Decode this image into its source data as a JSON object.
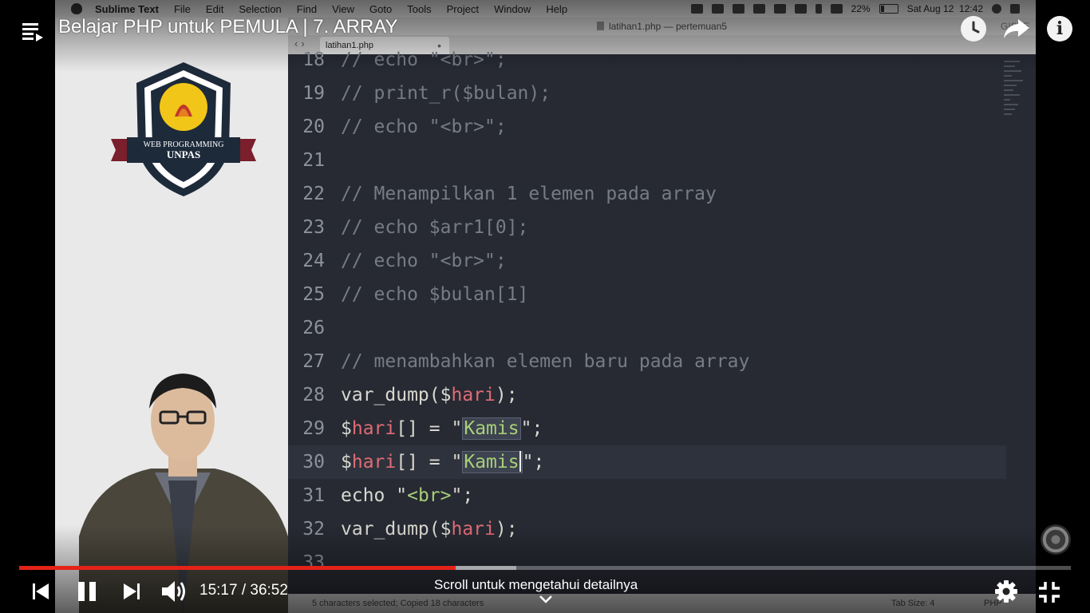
{
  "player": {
    "video_title": "Belajar PHP untuk PEMULA | 7. ARRAY",
    "current_time": "15:17",
    "duration": "36:52",
    "time_display": "15:17 / 36:52",
    "progress_fraction": 0.415,
    "buffered_fraction": 0.473,
    "scroll_hint": "Scroll untuk mengetahui detailnya",
    "accent_color": "#e52218",
    "icons": [
      "playlist-icon",
      "watch-later-icon",
      "share-icon",
      "info-icon",
      "previous-icon",
      "pause-icon",
      "next-icon",
      "volume-icon",
      "settings-icon",
      "exit-fullscreen-icon",
      "chevron-down-icon"
    ]
  },
  "menubar": {
    "app": "Sublime Text",
    "items": [
      "File",
      "Edit",
      "Selection",
      "Find",
      "View",
      "Goto",
      "Tools",
      "Project",
      "Window",
      "Help"
    ],
    "battery": "22%",
    "datetime": "Sat Aug 12  12:42"
  },
  "editor": {
    "window_title": "latihan1.php — pertemuan5",
    "register_label": "GISTE",
    "tab_label": "latihan1.php",
    "status_left": "5 characters selected; Copied 18 characters",
    "tab_size": "Tab Size: 4",
    "syntax": "PHP",
    "lines": [
      {
        "n": "18",
        "text": "// echo \"<br>\";"
      },
      {
        "n": "19",
        "text": "// print_r($bulan);"
      },
      {
        "n": "20",
        "text": "// echo \"<br>\";"
      },
      {
        "n": "21",
        "text": ""
      },
      {
        "n": "22",
        "text": "// Menampilkan 1 elemen pada array"
      },
      {
        "n": "23",
        "text": "// echo $arr1[0];"
      },
      {
        "n": "24",
        "text": "// echo \"<br>\";"
      },
      {
        "n": "25",
        "text": "// echo $bulan[1]"
      },
      {
        "n": "26",
        "text": ""
      },
      {
        "n": "27",
        "text": "// menambahkan elemen baru pada array"
      },
      {
        "n": "28",
        "text": "var_dump($hari);"
      },
      {
        "n": "29",
        "text": "$hari[] = \"Kamis\";"
      },
      {
        "n": "30",
        "text": "$hari[] = \"Kamis\";"
      },
      {
        "n": "31",
        "text": "echo \"<br>\";"
      },
      {
        "n": "32",
        "text": "var_dump($hari);"
      },
      {
        "n": "33",
        "text": ""
      }
    ]
  },
  "branding": {
    "logo_line1": "WEB PROGRAMMING",
    "logo_line2": "UNPAS"
  }
}
